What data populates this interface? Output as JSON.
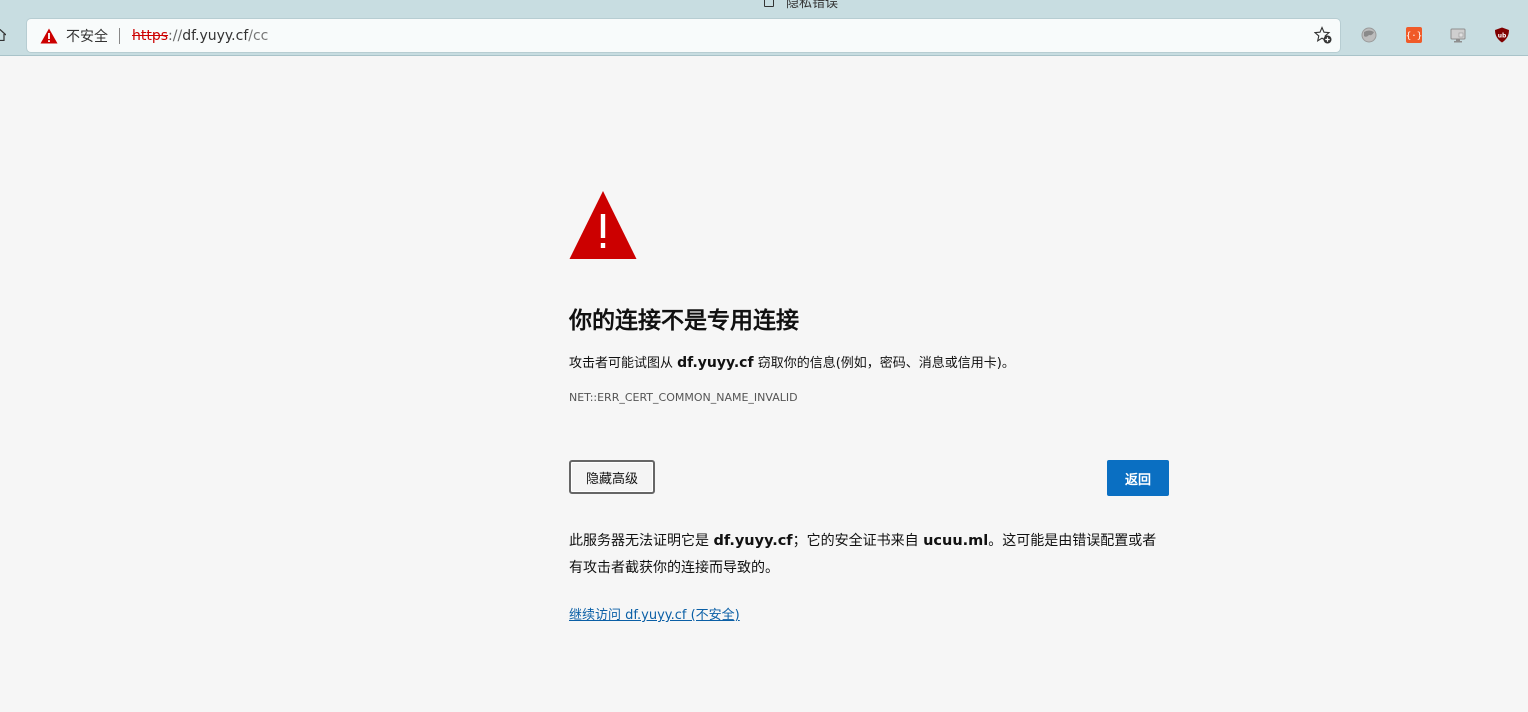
{
  "browser": {
    "tab_title": "隐私错误",
    "address_bar": {
      "security_label": "不安全",
      "url_scheme": "https",
      "url_separator": "://",
      "url_host": "df.yuyy.cf",
      "url_path": "/cc"
    },
    "icons": {
      "home": "home-icon",
      "security_warning": "warning-triangle-icon",
      "favorites": "add-favorite-star-icon",
      "extensions": [
        "extension-globe-icon",
        "extension-braces-icon",
        "extension-monitor-icon",
        "ublock-origin-icon"
      ]
    }
  },
  "error_page": {
    "icon": "large-warning-triangle-icon",
    "title": "你的连接不是专用连接",
    "description": {
      "prefix": "攻击者可能试图从 ",
      "host": "df.yuyy.cf",
      "suffix": " 窃取你的信息(例如，密码、消息或信用卡)。"
    },
    "error_code": "NET::ERR_CERT_COMMON_NAME_INVALID",
    "buttons": {
      "advanced_label": "隐藏高级",
      "back_label": "返回"
    },
    "details": {
      "part1": "此服务器无法证明它是 ",
      "host": "df.yuyy.cf",
      "part2": "；它的安全证书来自 ",
      "issuer": "ucuu.ml",
      "part3": "。这可能是由错误配置或者有攻击者截获你的连接而导致的。"
    },
    "proceed_link": "继续访问 df.yuyy.cf (不安全)"
  },
  "colors": {
    "warning_red": "#cc0000",
    "primary_button": "#0a6fc2",
    "link": "#0a5fa6",
    "chrome_bg": "#c8dde1",
    "page_bg": "#f6f6f6"
  }
}
